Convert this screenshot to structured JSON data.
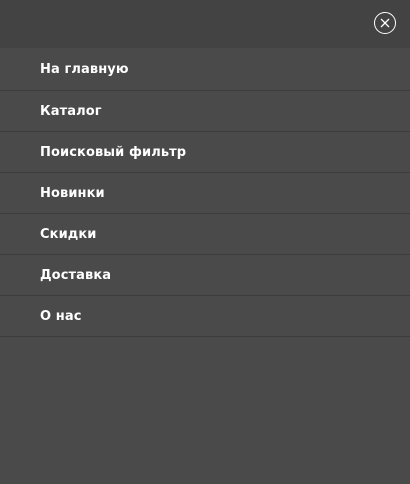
{
  "menu": {
    "close_icon": "close-icon",
    "items": [
      {
        "label": "На главную"
      },
      {
        "label": "Каталог"
      },
      {
        "label": "Поисковый фильтр"
      },
      {
        "label": "Новинки"
      },
      {
        "label": "Скидки"
      },
      {
        "label": "Доставка"
      },
      {
        "label": "О нас"
      }
    ]
  },
  "colors": {
    "panel_background": "#4a4a4a",
    "header_background": "#434343",
    "divider": "#3c3c3c",
    "text": "#ffffff"
  }
}
